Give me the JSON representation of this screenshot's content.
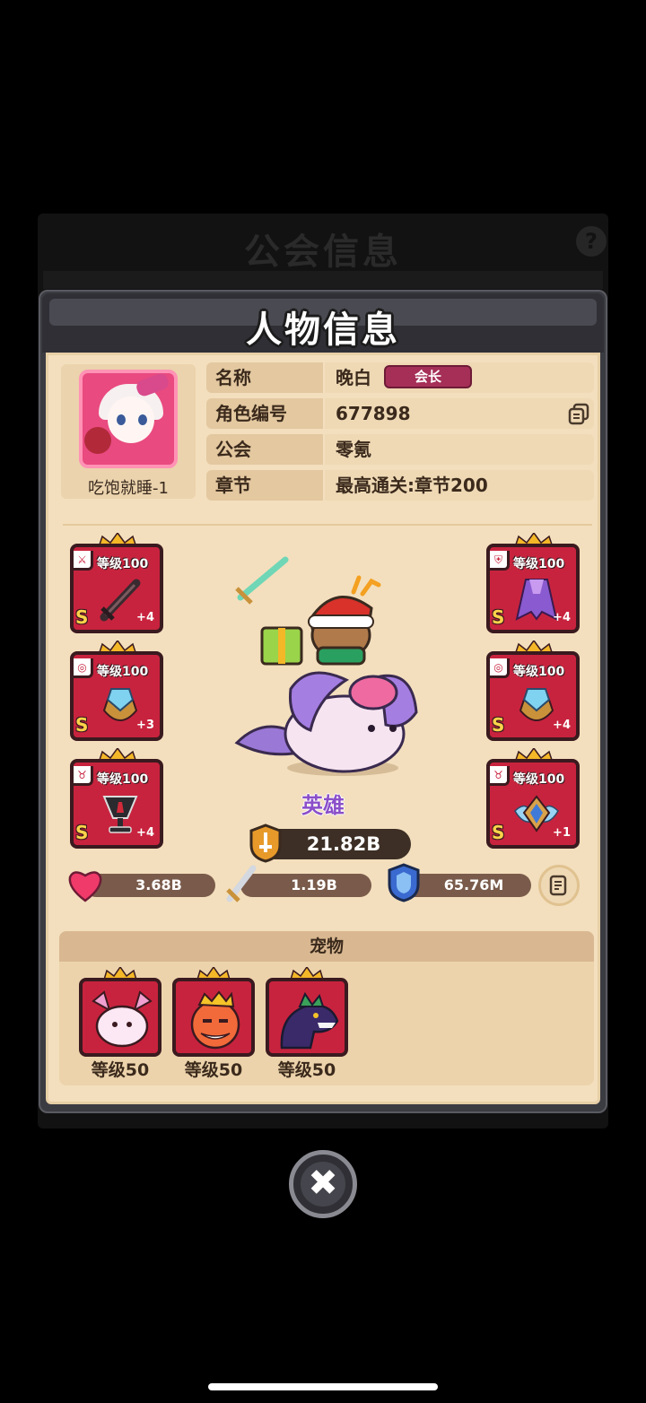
{
  "background": {
    "guild_title": "公会信息",
    "help_icon": "question-icon"
  },
  "dialog": {
    "title": "人物信息"
  },
  "player": {
    "avatar_name": "吃饱就睡-1",
    "info_rows": [
      {
        "label": "名称",
        "value": "晚白",
        "badge": "会长"
      },
      {
        "label": "角色编号",
        "value": "677898",
        "icon": "copy-icon"
      },
      {
        "label": "公会",
        "value": "零氪"
      },
      {
        "label": "章节",
        "value": "最高通关:章节200"
      }
    ]
  },
  "equipment": {
    "left": [
      {
        "slot": "weapon",
        "level": "等级100",
        "grade": "S",
        "plus": "+4",
        "icon": "sword-icon"
      },
      {
        "slot": "ring",
        "level": "等级100",
        "grade": "S",
        "plus": "+3",
        "icon": "gem-icon"
      },
      {
        "slot": "amulet",
        "level": "等级100",
        "grade": "S",
        "plus": "+4",
        "icon": "chalice-icon"
      }
    ],
    "right": [
      {
        "slot": "armor",
        "level": "等级100",
        "grade": "S",
        "plus": "+4",
        "icon": "cloak-icon"
      },
      {
        "slot": "ring",
        "level": "等级100",
        "grade": "S",
        "plus": "+4",
        "icon": "gem-icon"
      },
      {
        "slot": "amulet",
        "level": "等级100",
        "grade": "S",
        "plus": "+1",
        "icon": "winged-badge-icon"
      }
    ]
  },
  "hero": {
    "name": "英雄",
    "power": "21.82B"
  },
  "stats": {
    "hp": "3.68B",
    "attack": "1.19B",
    "defense": "65.76M"
  },
  "pets": {
    "title": "宠物",
    "items": [
      {
        "level": "等级50",
        "icon": "pink-cat-pet-icon"
      },
      {
        "level": "等级50",
        "icon": "king-pet-icon"
      },
      {
        "level": "等级50",
        "icon": "dark-dino-pet-icon"
      }
    ]
  },
  "colors": {
    "dialog_bg": "#3b3b42",
    "body_bg": "#f3dfbd",
    "equip_red": "#c8233e",
    "badge": "#a52f57",
    "hero_name": "#8a4fc9"
  }
}
